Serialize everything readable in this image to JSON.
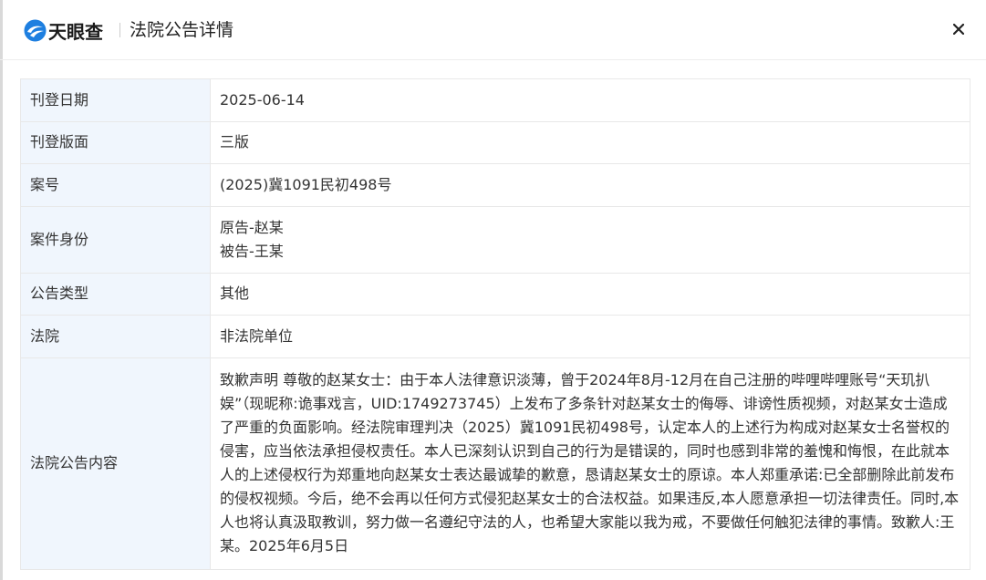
{
  "header": {
    "logo_text": "天眼查",
    "title": "法院公告详情"
  },
  "rows": [
    {
      "label": "刊登日期",
      "value": "2025-06-14"
    },
    {
      "label": "刊登版面",
      "value": "三版"
    },
    {
      "label": "案号",
      "value": "(2025)冀1091民初498号"
    },
    {
      "label": "案件身份",
      "value_lines": [
        "原告-赵某",
        "被告-王某"
      ]
    },
    {
      "label": "公告类型",
      "value": "其他"
    },
    {
      "label": "法院",
      "value": "非法院单位"
    },
    {
      "label": "法院公告内容",
      "value": "致歉声明 尊敬的赵某女士：由于本人法律意识淡薄，曾于2024年8月-12月在自己注册的哔哩哔哩账号“天玑扒娱”（现昵称:诡事戏言，UID:1749273745）上发布了多条针对赵某女士的侮辱、诽谤性质视频，对赵某女士造成了严重的负面影响。经法院审理判决（2025）冀1091民初498号，认定本人的上述行为构成对赵某女士名誉权的侵害，应当依法承担侵权责任。本人已深刻认识到自己的行为是错误的，同时也感到非常的羞愧和悔恨，在此就本人的上述侵权行为郑重地向赵某女士表达最诚挚的歉意，恳请赵某女士的原谅。本人郑重承诺:已全部删除此前发布的侵权视频。今后，绝不会再以任何方式侵犯赵某女士的合法权益。如果违反,本人愿意承担一切法律责任。同时,本人也将认真汲取教训，努力做一名遵纪守法的人，也希望大家能以我为戒，不要做任何触犯法律的事情。致歉人:王某。2025年6月5日"
    }
  ],
  "colors": {
    "label_bg": "#f0f6fd",
    "border": "#e8e8e8",
    "brand_blue": "#1e7fe0"
  },
  "icons": {
    "logo": "tianyancha-logo-icon",
    "close": "close-icon"
  }
}
